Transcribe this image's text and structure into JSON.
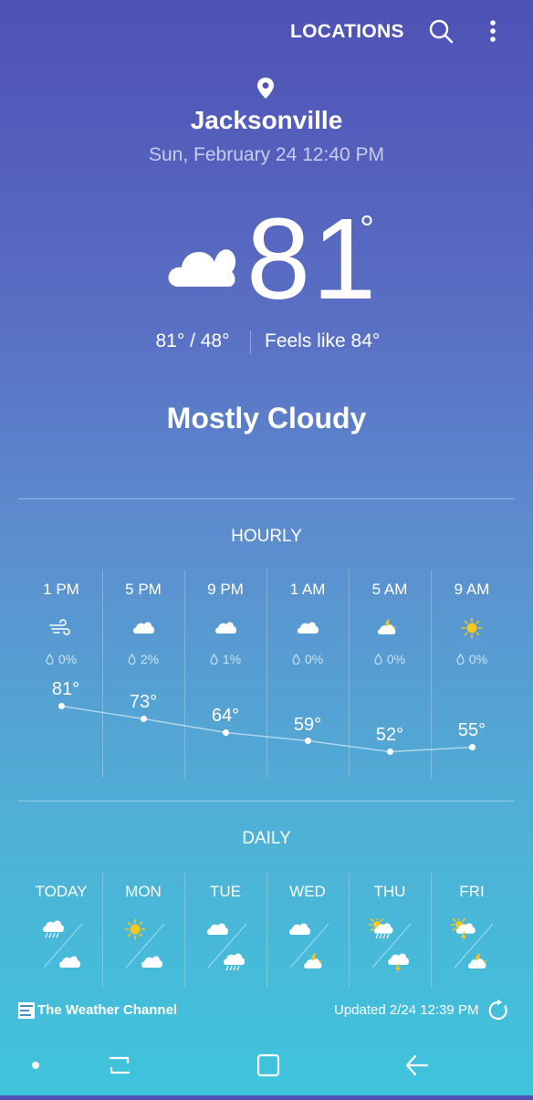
{
  "header": {
    "locations_label": "LOCATIONS",
    "search_icon": "search-icon",
    "more_icon": "more-vert-icon"
  },
  "current": {
    "location_icon": "location-pin-icon",
    "city": "Jacksonville",
    "datetime": "Sun, February 24 12:40 PM",
    "condition_icon": "cloud-icon",
    "temperature": "81",
    "degree_symbol": "°",
    "hi_lo": "81° / 48°",
    "feels_like": "Feels like 84°",
    "condition": "Mostly Cloudy"
  },
  "hourly": {
    "title": "HOURLY",
    "items": [
      {
        "time": "1 PM",
        "icon": "wind-icon",
        "precip": "0%",
        "temp": "81°"
      },
      {
        "time": "5 PM",
        "icon": "cloud-icon",
        "precip": "2%",
        "temp": "73°"
      },
      {
        "time": "9 PM",
        "icon": "cloud-icon",
        "precip": "1%",
        "temp": "64°"
      },
      {
        "time": "1 AM",
        "icon": "cloud-icon",
        "precip": "0%",
        "temp": "59°"
      },
      {
        "time": "5 AM",
        "icon": "moon-cloud-icon",
        "precip": "0%",
        "temp": "52°"
      },
      {
        "time": "9 AM",
        "icon": "sun-icon",
        "precip": "0%",
        "temp": "55°"
      }
    ]
  },
  "daily": {
    "title": "DAILY",
    "items": [
      {
        "day": "TODAY",
        "day_icon": "cloud-rain-icon",
        "night_icon": "cloud-icon"
      },
      {
        "day": "MON",
        "day_icon": "sun-icon",
        "night_icon": "cloud-icon"
      },
      {
        "day": "TUE",
        "day_icon": "cloud-icon",
        "night_icon": "cloud-rain-icon"
      },
      {
        "day": "WED",
        "day_icon": "cloud-icon",
        "night_icon": "moon-cloud-icon"
      },
      {
        "day": "THU",
        "day_icon": "sun-cloud-rain-icon",
        "night_icon": "cloud-thunder-icon"
      },
      {
        "day": "FRI",
        "day_icon": "sun-cloud-thunder-icon",
        "night_icon": "moon-cloud-icon"
      }
    ]
  },
  "footer": {
    "brand": "The Weather Channel",
    "updated": "Updated  2/24  12:39 PM",
    "refresh_icon": "refresh-icon"
  },
  "navbar": {
    "dot_icon": "dot-icon",
    "recents_icon": "recents-icon",
    "home_icon": "home-icon",
    "back_icon": "back-icon"
  },
  "colors": {
    "gradient_top": "#4f51b5",
    "gradient_bottom": "#3fc4dc",
    "sun": "#f7c71f",
    "moon": "#f3c325",
    "text": "#ffffff"
  }
}
